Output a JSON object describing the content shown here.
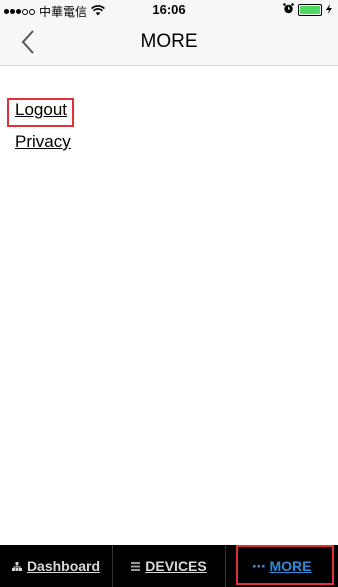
{
  "status_bar": {
    "carrier": "中華電信",
    "time": "16:06"
  },
  "nav": {
    "title": "MORE",
    "back_icon": "chevron-left-icon"
  },
  "menu": {
    "items": [
      {
        "label": "Logout"
      },
      {
        "label": "Privacy"
      }
    ]
  },
  "tab_bar": {
    "tabs": [
      {
        "label": "Dashboard",
        "icon": "org-chart-icon"
      },
      {
        "label": "DEVICES",
        "icon": "server-icon"
      },
      {
        "label": "MORE",
        "icon": "ellipsis-icon",
        "active": true
      }
    ]
  },
  "colors": {
    "accent": "#2f8bd8",
    "highlight": "#e0303a",
    "tab_bar_bg": "#000000"
  }
}
